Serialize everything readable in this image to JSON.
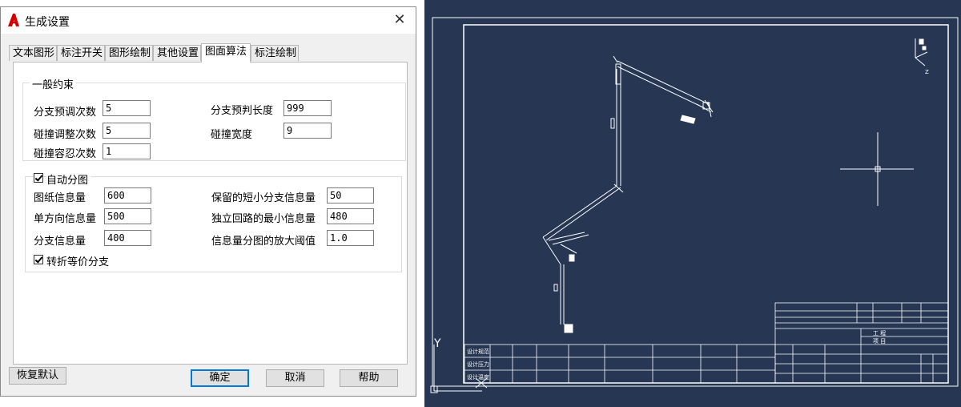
{
  "dialog": {
    "title": "生成设置",
    "close_glyph": "✕",
    "tabs": [
      "文本图形",
      "标注开关",
      "图形绘制",
      "其他设置",
      "图面算法",
      "标注绘制"
    ],
    "general": {
      "title": "一般约束",
      "branch_adjust_label": "分支预调次数",
      "branch_adjust_value": "5",
      "collision_adjust_label": "碰撞调整次数",
      "collision_adjust_value": "5",
      "collision_tolerance_label": "碰撞容忍次数",
      "collision_tolerance_value": "1",
      "branch_predict_len_label": "分支预判长度",
      "branch_predict_len_value": "999",
      "collision_width_label": "碰撞宽度",
      "collision_width_value": "9"
    },
    "auto": {
      "title": "自动分图",
      "sheet_info_label": "图纸信息量",
      "sheet_info_value": "600",
      "single_dir_label": "单方向信息量",
      "single_dir_value": "500",
      "branch_info_label": "分支信息量",
      "branch_info_value": "400",
      "min_branch_label": "保留的短小分支信息量",
      "min_branch_value": "50",
      "min_loop_label": "独立回路的最小信息量",
      "min_loop_value": "480",
      "amplify_label": "信息量分图的放大阈值",
      "amplify_value": "1.0"
    },
    "equiv_label": "转折等价分支",
    "buttons": {
      "restore": "恢复默认",
      "ok": "确定",
      "cancel": "取消",
      "help": "帮助"
    }
  },
  "cad": {
    "background": "#263653",
    "ucs_y": "Y",
    "view_cube_label": "Z",
    "title_block": {
      "left_cols": [
        "设计规范",
        "设计压力",
        "设计温度"
      ],
      "row2": [
        "工 程",
        "项 目"
      ]
    }
  },
  "colors": {
    "accent": "#0078d7",
    "logo_red": "#d40000",
    "cad_line": "#ffffff"
  }
}
